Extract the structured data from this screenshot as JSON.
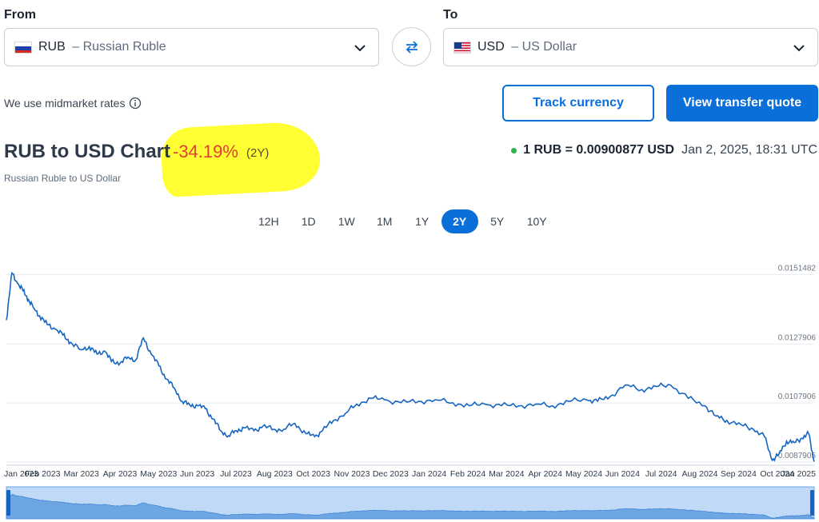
{
  "from": {
    "label": "From",
    "code": "RUB",
    "name": "Russian Ruble"
  },
  "to": {
    "label": "To",
    "code": "USD",
    "name": "US Dollar"
  },
  "midmarket_text": "We use midmarket rates",
  "buttons": {
    "track": "Track currency",
    "quote": "View transfer quote"
  },
  "header": {
    "title": "RUB to USD Chart",
    "change": "-34.19%",
    "change_period": "(2Y)",
    "subtitle": "Russian Ruble to US Dollar",
    "rate": "1 RUB = 0.00900877 USD",
    "timestamp": "Jan 2, 2025, 18:31 UTC"
  },
  "ranges": [
    {
      "label": "12H",
      "active": false
    },
    {
      "label": "1D",
      "active": false
    },
    {
      "label": "1W",
      "active": false
    },
    {
      "label": "1M",
      "active": false
    },
    {
      "label": "1Y",
      "active": false
    },
    {
      "label": "2Y",
      "active": true
    },
    {
      "label": "5Y",
      "active": false
    },
    {
      "label": "10Y",
      "active": false
    }
  ],
  "colors": {
    "accent": "#0a6fd8",
    "line": "#1565c0",
    "negative": "#e0412f",
    "highlight": "#ffff33",
    "live_dot": "#2fb351"
  },
  "icons": {
    "swap": "swap-arrows-icon",
    "info": "info-icon",
    "chevron": "chevron-down-icon",
    "flags": [
      "russia-flag-icon",
      "usa-flag-icon"
    ]
  },
  "chart_data": {
    "type": "line",
    "title": "",
    "xlabel": "",
    "ylabel": "",
    "x_ticks": [
      "Jan 2023",
      "Feb 2023",
      "Mar 2023",
      "Apr 2023",
      "May 2023",
      "Jun 2023",
      "Jul 2023",
      "Aug 2023",
      "Oct 2023",
      "Nov 2023",
      "Dec 2023",
      "Jan 2024",
      "Feb 2024",
      "Mar 2024",
      "Apr 2024",
      "May 2024",
      "Jun 2024",
      "Jul 2024",
      "Aug 2024",
      "Sep 2024",
      "Oct 2024",
      "Jan 2025"
    ],
    "y_ticks": [
      0.0151482,
      0.0127906,
      0.0107906,
      0.0087905
    ],
    "y_tick_labels": [
      "0.0151482",
      "0.0127906",
      "0.0107906",
      "0.0087905"
    ],
    "ylim": [
      0.00868,
      0.016
    ],
    "xlim": [
      "2023-01-02",
      "2025-01-02"
    ],
    "grid": true,
    "series": [
      {
        "x": [
          "2023-01-02",
          "2023-01-07",
          "2023-01-12",
          "2023-01-17",
          "2023-01-22",
          "2023-01-27",
          "2023-02-01",
          "2023-02-08",
          "2023-02-15",
          "2023-02-22",
          "2023-03-01",
          "2023-03-10",
          "2023-03-18",
          "2023-03-25",
          "2023-04-01",
          "2023-04-07",
          "2023-04-15",
          "2023-04-22",
          "2023-04-29",
          "2023-05-06",
          "2023-05-13",
          "2023-05-20",
          "2023-05-27",
          "2023-06-03",
          "2023-06-10",
          "2023-06-17",
          "2023-06-24",
          "2023-07-01",
          "2023-07-08",
          "2023-07-15",
          "2023-07-22",
          "2023-07-29",
          "2023-08-05",
          "2023-08-14",
          "2023-08-22",
          "2023-09-01",
          "2023-09-10",
          "2023-09-20",
          "2023-09-30",
          "2023-10-08",
          "2023-10-15",
          "2023-10-25",
          "2023-11-05",
          "2023-11-15",
          "2023-11-28",
          "2023-12-10",
          "2023-12-25",
          "2024-01-10",
          "2024-01-25",
          "2024-02-10",
          "2024-02-25",
          "2024-03-10",
          "2024-03-25",
          "2024-04-10",
          "2024-04-25",
          "2024-05-10",
          "2024-05-25",
          "2024-06-10",
          "2024-06-20",
          "2024-07-01",
          "2024-07-15",
          "2024-07-30",
          "2024-08-12",
          "2024-08-25",
          "2024-09-10",
          "2024-09-25",
          "2024-10-05",
          "2024-10-15",
          "2024-10-28",
          "2024-11-08",
          "2024-11-18",
          "2024-11-25",
          "2024-12-01",
          "2024-12-08",
          "2024-12-15",
          "2024-12-22",
          "2024-12-28",
          "2025-01-02"
        ],
        "values": [
          0.0136,
          0.0152,
          0.01485,
          0.0146,
          0.0143,
          0.014,
          0.01375,
          0.01345,
          0.0133,
          0.0131,
          0.01285,
          0.0126,
          0.0127,
          0.01245,
          0.01255,
          0.0122,
          0.01215,
          0.01235,
          0.01225,
          0.013,
          0.01245,
          0.01205,
          0.0116,
          0.0113,
          0.01085,
          0.01072,
          0.0107,
          0.0106,
          0.01025,
          0.00985,
          0.00968,
          0.00985,
          0.00995,
          0.00985,
          0.01,
          0.0099,
          0.0099,
          0.0101,
          0.00975,
          0.00965,
          0.00985,
          0.0102,
          0.01045,
          0.01075,
          0.01095,
          0.0109,
          0.0108,
          0.01085,
          0.0109,
          0.0108,
          0.0107,
          0.01075,
          0.0107,
          0.0107,
          0.01075,
          0.0107,
          0.01085,
          0.0109,
          0.01085,
          0.011,
          0.0114,
          0.01125,
          0.01135,
          0.0114,
          0.01095,
          0.0107,
          0.01035,
          0.0102,
          0.01005,
          0.0099,
          0.00965,
          0.00885,
          0.00905,
          0.0095,
          0.00945,
          0.0096,
          0.00975,
          0.0088
        ]
      }
    ]
  }
}
